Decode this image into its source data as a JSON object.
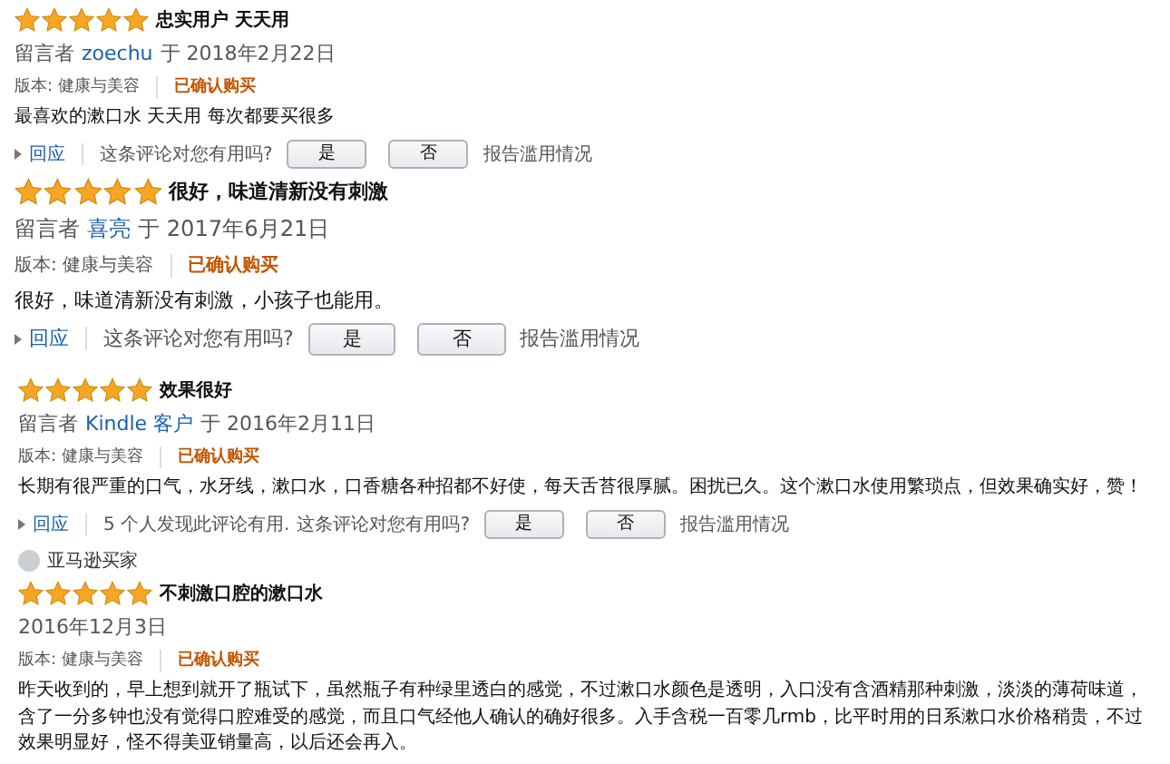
{
  "reviews": [
    {
      "stars": 5,
      "title": "忠实用户 天天用",
      "by_label": "留言者",
      "author": "zoechu",
      "date": "于 2018年2月22日",
      "version": "版本: 健康与美容",
      "verified": "已确认购买",
      "body": "最喜欢的漱口水 天天用 每次都要买很多",
      "reply": "回应",
      "question": "这条评论对您有用吗?",
      "yes": "是",
      "no": "否",
      "report": "报告滥用情况"
    },
    {
      "stars": 5,
      "title": "很好，味道清新没有刺激",
      "by_label": "留言者",
      "author": "喜亮",
      "date": "于 2017年6月21日",
      "version": "版本: 健康与美容",
      "verified": "已确认购买",
      "body": "很好，味道清新没有刺激，小孩子也能用。",
      "reply": "回应",
      "question": "这条评论对您有用吗?",
      "yes": "是",
      "no": "否",
      "report": "报告滥用情况"
    },
    {
      "stars": 5,
      "title": "效果很好",
      "by_label": "留言者",
      "author": "Kindle 客户",
      "date": "于 2016年2月11日",
      "version": "版本: 健康与美容",
      "verified": "已确认购买",
      "body": "长期有很严重的口气，水牙线，漱口水，口香糖各种招都不好使，每天舌苔很厚腻。困扰已久。这个漱口水使用繁琐点，但效果确实好，赞！",
      "reply": "回应",
      "helpful_note": "5 个人发现此评论有用.",
      "question": "这条评论对您有用吗?",
      "yes": "是",
      "no": "否",
      "report": "报告滥用情况"
    },
    {
      "reviewer": "亚马逊买家",
      "stars": 5,
      "title": "不刺激口腔的漱口水",
      "date": "2016年12月3日",
      "version": "版本: 健康与美容",
      "verified": "已确认购买",
      "body": "昨天收到的，早上想到就开了瓶试下，虽然瓶子有种绿里透白的感觉，不过漱口水颜色是透明，入口没有含酒精那种刺激，淡淡的薄荷味道，含了一分多钟也没有觉得口腔难受的感觉，而且口气经他人确认的确好很多。入手含税一百零几rmb，比平时用的日系漱口水价格稍贵，不过效果明显好，怪不得美亚销量高，以后还会再入。"
    }
  ]
}
